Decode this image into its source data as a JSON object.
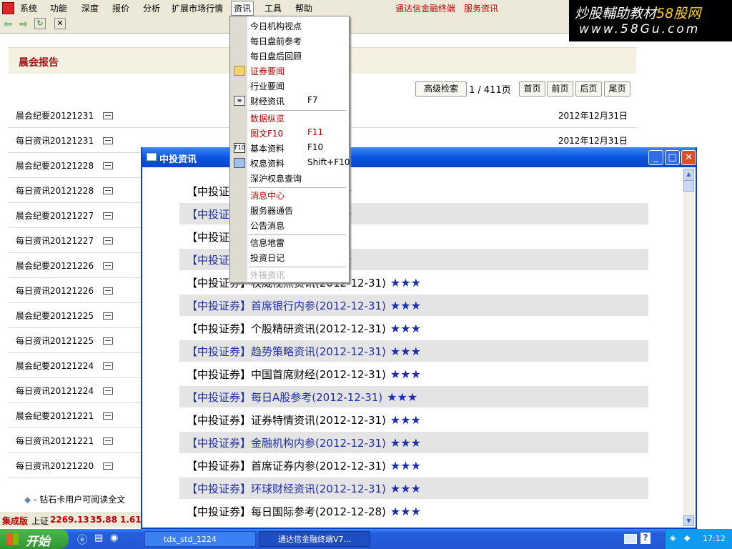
{
  "menubar": {
    "items": [
      "系统",
      "功能",
      "深度",
      "报价",
      "分析",
      "扩展市场行情",
      "资讯",
      "工具",
      "帮助"
    ],
    "red_links": [
      "通达信金融终端",
      "服务资讯"
    ]
  },
  "watermark": {
    "line1_a": "炒股輔助教材",
    "line1_b": "58股网",
    "line2": "www.58Gu.com"
  },
  "report": {
    "title": "晨会报告",
    "buttons": {
      "advanced_search": "高级检索",
      "first": "首页",
      "prev": "前页",
      "next": "后页",
      "last": "尾页"
    },
    "pager": "1 / 411页",
    "rows": [
      {
        "title": "晨会纪要20121231",
        "date": "2012年12月31日"
      },
      {
        "title": "每日资讯20121231",
        "date": "2012年12月31日"
      },
      {
        "title": "晨会纪要20121228",
        "date": ""
      },
      {
        "title": "每日资讯20121228",
        "date": ""
      },
      {
        "title": "晨会纪要20121227",
        "date": ""
      },
      {
        "title": "每日资讯20121227",
        "date": ""
      },
      {
        "title": "晨会纪要20121226",
        "date": ""
      },
      {
        "title": "每日资讯20121226",
        "date": ""
      },
      {
        "title": "晨会纪要20121225",
        "date": ""
      },
      {
        "title": "每日资讯20121225",
        "date": ""
      },
      {
        "title": "晨会纪要20121224",
        "date": ""
      },
      {
        "title": "每日资讯20121224",
        "date": ""
      },
      {
        "title": "晨会纪要20121221",
        "date": ""
      },
      {
        "title": "每日资讯20121221",
        "date": ""
      },
      {
        "title": "每日资讯20121220",
        "date": ""
      }
    ],
    "diamond_note": "- 钻石卡用户可阅读全文"
  },
  "status": {
    "edition": "集成版",
    "index_label": "上证",
    "index_value": "2269.13",
    "change": "35.88",
    "pct": "1.61"
  },
  "dialog": {
    "title": "中投资讯",
    "rows": [
      {
        "text": "【中投证券】",
        "date": "2012-12-31)",
        "stars": "★★★"
      },
      {
        "text": "【中投证券】",
        "date": "2012-12-31)",
        "stars": "★★★"
      },
      {
        "text": "【中投证券】",
        "date": "31)",
        "stars": "★★★"
      },
      {
        "text": "【中投证券】",
        "date": "2012-12-31)",
        "stars": "★★★"
      },
      {
        "text": "【中投证券】权威视点资讯(",
        "date": "2012-12-31)",
        "stars": "★★★"
      },
      {
        "text": "【中投证券】首席银行内参(",
        "date": "2012-12-31)",
        "stars": "★★★"
      },
      {
        "text": "【中投证券】个股精研资讯(",
        "date": "2012-12-31)",
        "stars": "★★★"
      },
      {
        "text": "【中投证券】趋势策略资讯(",
        "date": "2012-12-31)",
        "stars": "★★★"
      },
      {
        "text": "【中投证券】中国首席财经(",
        "date": "2012-12-31)",
        "stars": "★★★"
      },
      {
        "text": "【中投证券】每日A股参考(",
        "date": "2012-12-31)",
        "stars": "★★★"
      },
      {
        "text": "【中投证券】证券特情资讯(",
        "date": "2012-12-31)",
        "stars": "★★★"
      },
      {
        "text": "【中投证券】金融机构内参(",
        "date": "2012-12-31)",
        "stars": "★★★"
      },
      {
        "text": "【中投证券】首席证券内参(",
        "date": "2012-12-31)",
        "stars": "★★★"
      },
      {
        "text": "【中投证券】环球财经资讯(",
        "date": "2012-12-31)",
        "stars": "★★★"
      },
      {
        "text": "【中投证券】每日国际参考(",
        "date": "2012-12-28)",
        "stars": "★★★"
      }
    ]
  },
  "dropdown": {
    "items": [
      {
        "label": "今日机构视点",
        "shortcut": ""
      },
      {
        "label": "每日盘前参考",
        "shortcut": ""
      },
      {
        "label": "每日盘后回顾",
        "shortcut": ""
      },
      {
        "label": "证券要闻",
        "shortcut": ""
      },
      {
        "label": "行业要闻",
        "shortcut": ""
      },
      {
        "label": "财经资讯",
        "shortcut": "F7"
      },
      {
        "label": "数据纵览",
        "shortcut": ""
      },
      {
        "label": "图文F10",
        "shortcut": "F11"
      },
      {
        "label": "基本资料",
        "shortcut": "F10"
      },
      {
        "label": "权息资料",
        "shortcut": "Shift+F10"
      },
      {
        "label": "深沪权息查询",
        "shortcut": ""
      },
      {
        "label": "消息中心",
        "shortcut": ""
      },
      {
        "label": "服务器通告",
        "shortcut": ""
      },
      {
        "label": "公告消息",
        "shortcut": ""
      },
      {
        "label": "信息地雷",
        "shortcut": ""
      },
      {
        "label": "投资日记",
        "shortcut": ""
      },
      {
        "label": "外接资讯",
        "shortcut": ""
      }
    ]
  },
  "taskbar": {
    "start": "开始",
    "task1": "tdx_std_1224",
    "task2": "通达信金融终端V7...",
    "time": "17:12"
  }
}
